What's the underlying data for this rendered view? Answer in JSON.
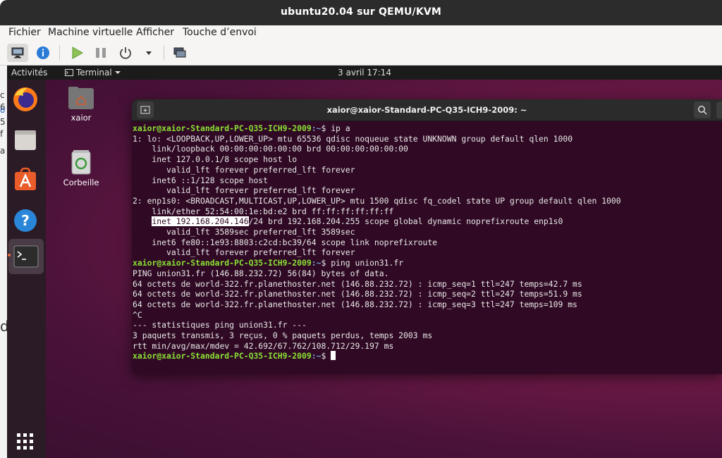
{
  "window": {
    "title": "ubuntu20.04 sur QEMU/KVM"
  },
  "menu": [
    "Fichier",
    "Machine virtuelle",
    "Afficher",
    "Touche d’envoi"
  ],
  "toolbar": [
    "monitor-icon",
    "info-icon",
    "play-icon",
    "pause-icon",
    "power-icon",
    "dropdown-icon",
    "screens-icon"
  ],
  "host_strip": [
    "c",
    "6",
    "o",
    "5",
    "f",
    "a",
    "d"
  ],
  "guest": {
    "topbar": {
      "activities": "Activités",
      "app": "Terminal",
      "clock": "3 avril  17:14"
    },
    "desktop_icons": [
      {
        "label": "xaior"
      },
      {
        "label": "Corbeille"
      }
    ],
    "dock": [
      "firefox-icon",
      "files-icon",
      "software-icon",
      "help-icon",
      "terminal-icon",
      "apps-grid-icon"
    ]
  },
  "terminal": {
    "title": "xaior@xaior-Standard-PC-Q35-ICH9-2009: ~",
    "prompt_user": "xaior@xaior-Standard-PC-Q35-ICH9-2009",
    "prompt_path": ":~",
    "prompt_symbol": "$ ",
    "cmd1": "ip a",
    "lines_a": [
      "1: lo: <LOOPBACK,UP,LOWER_UP> mtu 65536 qdisc noqueue state UNKNOWN group default qlen 1000",
      "    link/loopback 00:00:00:00:00:00 brd 00:00:00:00:00:00",
      "    inet 127.0.0.1/8 scope host lo",
      "       valid_lft forever preferred_lft forever",
      "    inet6 ::1/128 scope host",
      "       valid_lft forever preferred_lft forever",
      "2: enp1s0: <BROADCAST,MULTICAST,UP,LOWER_UP> mtu 1500 qdisc fq_codel state UP group default qlen 1000",
      "    link/ether 52:54:00:1e:bd:e2 brd ff:ff:ff:ff:ff:ff"
    ],
    "hl_prefix": "    ",
    "hl_text": "inet 192.168.204.146",
    "hl_rest": "/24 brd 192.168.204.255 scope global dynamic noprefixroute enp1s0",
    "lines_b": [
      "       valid_lft 3589sec preferred_lft 3589sec",
      "    inet6 fe80::1e93:8803:c2cd:bc39/64 scope link noprefixroute",
      "       valid_lft forever preferred_lft forever"
    ],
    "cmd2": "ping union31.fr",
    "lines_c": [
      "PING union31.fr (146.88.232.72) 56(84) bytes of data.",
      "64 octets de world-322.fr.planethoster.net (146.88.232.72) : icmp_seq=1 ttl=247 temps=42.7 ms",
      "64 octets de world-322.fr.planethoster.net (146.88.232.72) : icmp_seq=2 ttl=247 temps=51.9 ms",
      "64 octets de world-322.fr.planethoster.net (146.88.232.72) : icmp_seq=3 ttl=247 temps=109 ms",
      "^C",
      "--- statistiques ping union31.fr ---",
      "3 paquets transmis, 3 reçus, 0 % paquets perdus, temps 2003 ms",
      "rtt min/avg/max/mdev = 42.692/67.762/108.712/29.197 ms"
    ]
  }
}
